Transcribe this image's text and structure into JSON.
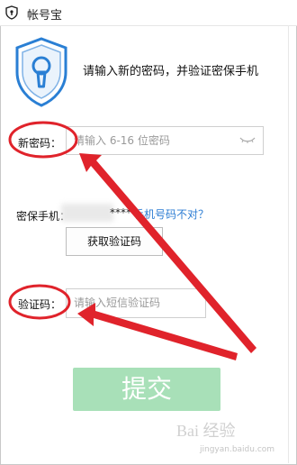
{
  "window": {
    "title": "帐号宝"
  },
  "header": {
    "headline": "请输入新的密码，并验证密保手机"
  },
  "password": {
    "label": "新密码：",
    "placeholder": "请输入 6-16 位密码"
  },
  "phone": {
    "label": "密保手机：",
    "masked": "*****",
    "change_link": "手机号码不对？"
  },
  "get_code_button": {
    "label": "获取验证码"
  },
  "sms": {
    "label": "验证码：",
    "placeholder": "请输入短信验证码"
  },
  "submit_button": {
    "label": "提交"
  },
  "watermark": {
    "text": "Bai 经验",
    "sub": "jingyan.baidu.com"
  },
  "colors": {
    "accent_link": "#2b7cd3",
    "submit_bg": "#a8e0b8",
    "shield": "#2a7fd4",
    "annotation": "#e0232b"
  },
  "icons": [
    "shield-lock-icon",
    "eye-closed-icon",
    "window-shield-icon"
  ]
}
